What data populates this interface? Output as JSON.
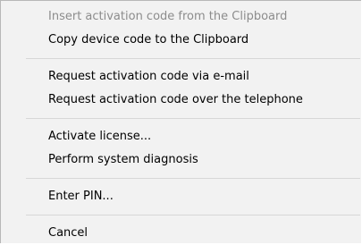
{
  "context_menu": {
    "items": [
      {
        "label": "Insert activation code from the Clipboard",
        "enabled": false
      },
      {
        "label": "Copy device code to the Clipboard",
        "enabled": true
      },
      {
        "label": "Request activation code via e-mail",
        "enabled": true
      },
      {
        "label": "Request activation code over the telephone",
        "enabled": true
      },
      {
        "label": "Activate license...",
        "enabled": true
      },
      {
        "label": "Perform system diagnosis",
        "enabled": true
      },
      {
        "label": "Enter PIN...",
        "enabled": true
      },
      {
        "label": "Cancel",
        "enabled": true
      }
    ],
    "colors": {
      "background": "#f2f2f2",
      "text": "#000000",
      "disabled_text": "#8c8c8c",
      "separator": "#d7d7d7"
    }
  }
}
